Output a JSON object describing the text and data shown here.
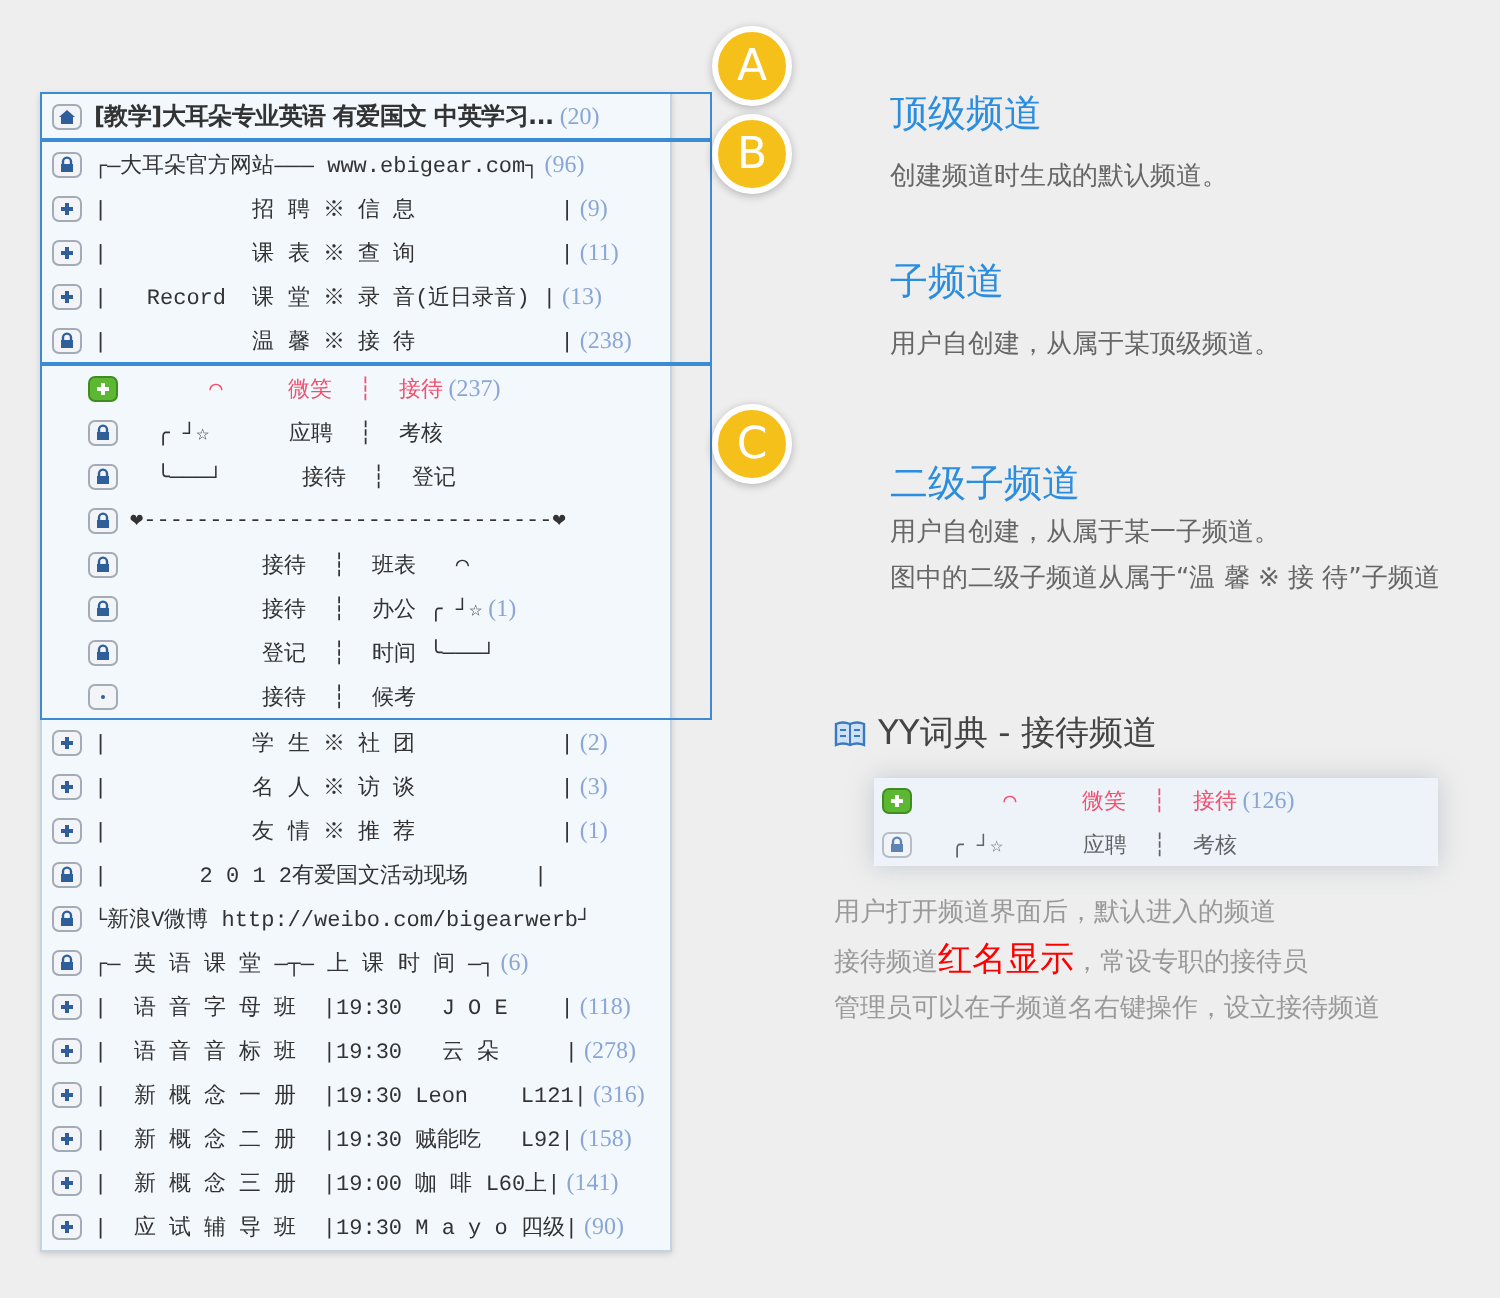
{
  "channels": [
    {
      "kind": "home",
      "name": "[教学]大耳朵专业英语 有爱国文 中英学习...",
      "count": "(20)",
      "highlighted": false,
      "children": [
        {
          "kind": "lock",
          "name": "┌—大耳朵官方网站——— www.ebigear.com┐",
          "count": "(96)",
          "highlighted": false
        },
        {
          "kind": "plus",
          "name": "|           招 聘 ※ 信 息           |",
          "count": "(9)",
          "highlighted": false
        },
        {
          "kind": "plus",
          "name": "|           课 表 ※ 查 询           |",
          "count": "(11)",
          "highlighted": false
        },
        {
          "kind": "plus",
          "name": "|   Record  课 堂 ※ 录 音(近日录音) |",
          "count": "(13)",
          "highlighted": false
        },
        {
          "kind": "lock",
          "name": "|           温 馨 ※ 接 待           |",
          "count": "(238)",
          "highlighted": false,
          "children": [
            {
              "kind": "reception",
              "name": "      ◠     微笑  ┆  接待",
              "count": "(237)",
              "highlighted": true
            },
            {
              "kind": "lock",
              "name": "  ╭ ┘☆      应聘  ┆  考核",
              "highlighted": false
            },
            {
              "kind": "lock",
              "name": "  ╰───┘      接待  ┆  登记",
              "highlighted": false
            },
            {
              "kind": "lock",
              "name": "❤-------------------------------❤",
              "highlighted": false
            },
            {
              "kind": "lock",
              "name": "          接待  ┆  班表   ◠",
              "highlighted": false
            },
            {
              "kind": "lock",
              "name": "          接待  ┆  办公 ╭ ┘☆",
              "count": "(1)",
              "highlighted": false
            },
            {
              "kind": "lock",
              "name": "          登记  ┆  时间 ╰───┘",
              "highlighted": false
            },
            {
              "kind": "dot",
              "name": "          接待  ┆  候考",
              "highlighted": false
            }
          ]
        },
        {
          "kind": "plus",
          "name": "|           学 生 ※ 社 团           |",
          "count": "(2)",
          "highlighted": false
        },
        {
          "kind": "plus",
          "name": "|           名 人 ※ 访 谈           |",
          "count": "(3)",
          "highlighted": false
        },
        {
          "kind": "plus",
          "name": "|           友 情 ※ 推 荐           |",
          "count": "(1)",
          "highlighted": false
        },
        {
          "kind": "lock",
          "name": "|       2 0 1 2有爱国文活动现场     |",
          "highlighted": false
        },
        {
          "kind": "lock",
          "name": "└新浪V微博 http://weibo.com/bigearwerb┘",
          "highlighted": false
        },
        {
          "kind": "lock",
          "name": "┌— 英 语 课 堂 —┬— 上 课 时 间 —┐",
          "count": "(6)",
          "highlighted": false
        },
        {
          "kind": "plus",
          "name": "|  语 音 字 母 班  |19:30   J O E    |",
          "count": "(118)",
          "highlighted": false
        },
        {
          "kind": "plus",
          "name": "|  语 音 音 标 班  |19:30   云 朵     |",
          "count": "(278)",
          "highlighted": false
        },
        {
          "kind": "plus",
          "name": "|  新 概 念 一 册  |19:30 Leon    L121|",
          "count": "(316)",
          "highlighted": false
        },
        {
          "kind": "plus",
          "name": "|  新 概 念 二 册  |19:30 贼能吃   L92|",
          "count": "(158)",
          "highlighted": false
        },
        {
          "kind": "plus",
          "name": "|  新 概 念 三 册  |19:00 咖 啡 L60上|",
          "count": "(141)",
          "highlighted": false
        },
        {
          "kind": "plus",
          "name": "|  应 试 辅 导 班  |19:30 M a y o 四级|",
          "count": "(90)",
          "highlighted": false
        }
      ]
    }
  ],
  "callouts": [
    {
      "letter": "A",
      "title": "顶级频道",
      "lines": [
        "创建频道时生成的默认频道。"
      ]
    },
    {
      "letter": "B",
      "title": "子频道",
      "lines": [
        "用户自创建，从属于某顶级频道。"
      ]
    },
    {
      "letter": "C",
      "title": "二级子频道",
      "lines": [
        "用户自创建，从属于某一子频道。",
        "图中的二级子频道从属于“温 馨 ※ 接 待”子频道"
      ]
    }
  ],
  "dictionary": {
    "title": "YY词典 - 接待频道",
    "preview_rows": [
      {
        "kind": "reception",
        "name": "      ◠     微笑  ┆  接待",
        "count": "(126)",
        "highlighted": true
      },
      {
        "kind": "lock",
        "name": "  ╭ ┘☆      应聘  ┆  考核",
        "highlighted": false
      }
    ],
    "lines": [
      "用户打开频道界面后，默认进入的频道",
      "接待频道**红名显示**，常设专职的接待员",
      "管理员可以在子频道名右键操作，设立接待频道"
    ]
  }
}
